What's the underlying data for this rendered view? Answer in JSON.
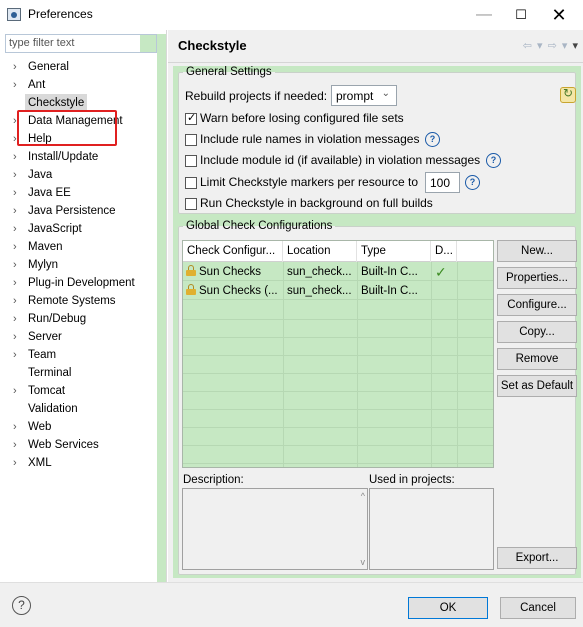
{
  "window": {
    "title": "Preferences",
    "min": "—",
    "max": "☐",
    "close": "✕"
  },
  "filter": {
    "placeholder": "type filter text"
  },
  "tree": [
    {
      "label": "General",
      "arrow": true
    },
    {
      "label": "Ant",
      "arrow": true
    },
    {
      "label": "Checkstyle",
      "arrow": false,
      "selected": true
    },
    {
      "label": "Data Management",
      "arrow": true
    },
    {
      "label": "Help",
      "arrow": true
    },
    {
      "label": "Install/Update",
      "arrow": true
    },
    {
      "label": "Java",
      "arrow": true
    },
    {
      "label": "Java EE",
      "arrow": true
    },
    {
      "label": "Java Persistence",
      "arrow": true
    },
    {
      "label": "JavaScript",
      "arrow": true
    },
    {
      "label": "Maven",
      "arrow": true
    },
    {
      "label": "Mylyn",
      "arrow": true
    },
    {
      "label": "Plug-in Development",
      "arrow": true
    },
    {
      "label": "Remote Systems",
      "arrow": true
    },
    {
      "label": "Run/Debug",
      "arrow": true
    },
    {
      "label": "Server",
      "arrow": true
    },
    {
      "label": "Team",
      "arrow": true
    },
    {
      "label": "Terminal",
      "arrow": false
    },
    {
      "label": "Tomcat",
      "arrow": true
    },
    {
      "label": "Validation",
      "arrow": false
    },
    {
      "label": "Web",
      "arrow": true
    },
    {
      "label": "Web Services",
      "arrow": true
    },
    {
      "label": "XML",
      "arrow": true
    }
  ],
  "page": {
    "title": "Checkstyle",
    "nav": {
      "back": "⇦",
      "back_menu": "▾",
      "forward": "⇨",
      "forward_menu": "▾",
      "view_menu": "▾"
    }
  },
  "general": {
    "legend": "General Settings",
    "rebuild_label": "Rebuild projects if needed:",
    "rebuild_value": "prompt",
    "warn_label": "Warn before losing configured file sets",
    "warn_checked": true,
    "include_rule_label": "Include rule names in violation messages",
    "include_module_label": "Include module id (if available) in violation messages",
    "limit_label": "Limit Checkstyle markers per resource to",
    "limit_value": "100",
    "background_label": "Run Checkstyle in background on full builds",
    "help_glyph": "?"
  },
  "global": {
    "legend": "Global Check Configurations",
    "columns": [
      "Check Configur...",
      "Location",
      "Type",
      "D..."
    ],
    "rows": [
      {
        "name": "Sun Checks",
        "location": "sun_check...",
        "type": "Built-In C...",
        "default": "✓"
      },
      {
        "name": "Sun Checks (...",
        "location": "sun_check...",
        "type": "Built-In C...",
        "default": ""
      }
    ],
    "buttons": {
      "new": "New...",
      "properties": "Properties...",
      "configure": "Configure...",
      "copy": "Copy...",
      "remove": "Remove",
      "set_default": "Set as Default",
      "export": "Export..."
    },
    "description_label": "Description:",
    "used_in_label": "Used in projects:"
  },
  "footer": {
    "help": "?",
    "ok": "OK",
    "cancel": "Cancel"
  }
}
